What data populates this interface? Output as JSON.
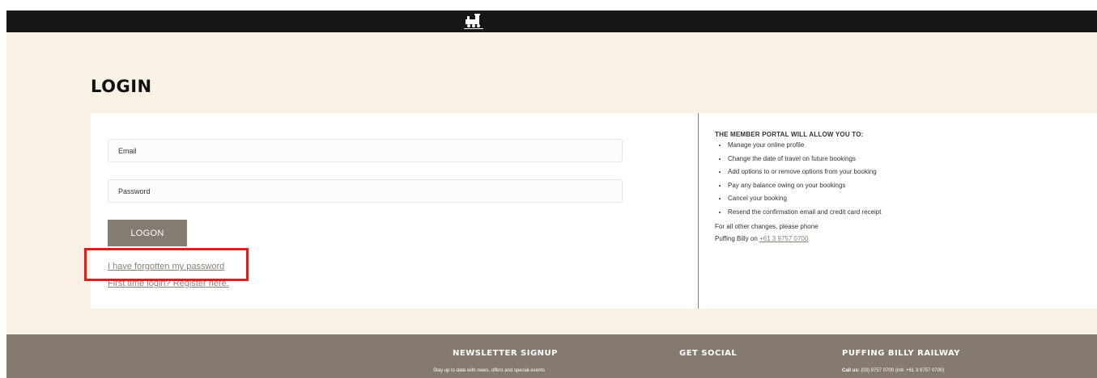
{
  "header": {
    "logo_icon": "train-logo-icon"
  },
  "page": {
    "title": "LOGIN"
  },
  "form": {
    "email_placeholder": "Email",
    "password_placeholder": "Password",
    "logon_label": "LOGON",
    "forgot_link": "I have forgotten my password",
    "register_link": "First time login? Register here."
  },
  "info": {
    "heading": "THE MEMBER PORTAL WILL ALLOW YOU TO:",
    "items": [
      "Manage your online profile",
      "Change the date of travel on future bookings",
      "Add options to or remove options from your booking",
      "Pay any balance owing on your bookings",
      "Cancel your booking",
      "Resend the confirmation email and credit card receipt"
    ],
    "phone_intro": "For all other changes, please phone",
    "phone_prefix": "Puffing Billy on",
    "phone_number": "+61 3 9757 0700"
  },
  "footer": {
    "newsletter_title": "NEWSLETTER SIGNUP",
    "newsletter_text": "Stay up to date with news, offers and special events",
    "social_title": "GET SOCIAL",
    "railway_title": "PUFFING BILLY RAILWAY",
    "call_label": "Call us:",
    "call_text": "(03) 9757 0700 (Intl. +61 3 9757 0700)"
  },
  "colors": {
    "topbar": "#171717",
    "background": "#f9f2e4",
    "accent": "#847b71",
    "highlight": "#d6211f"
  }
}
